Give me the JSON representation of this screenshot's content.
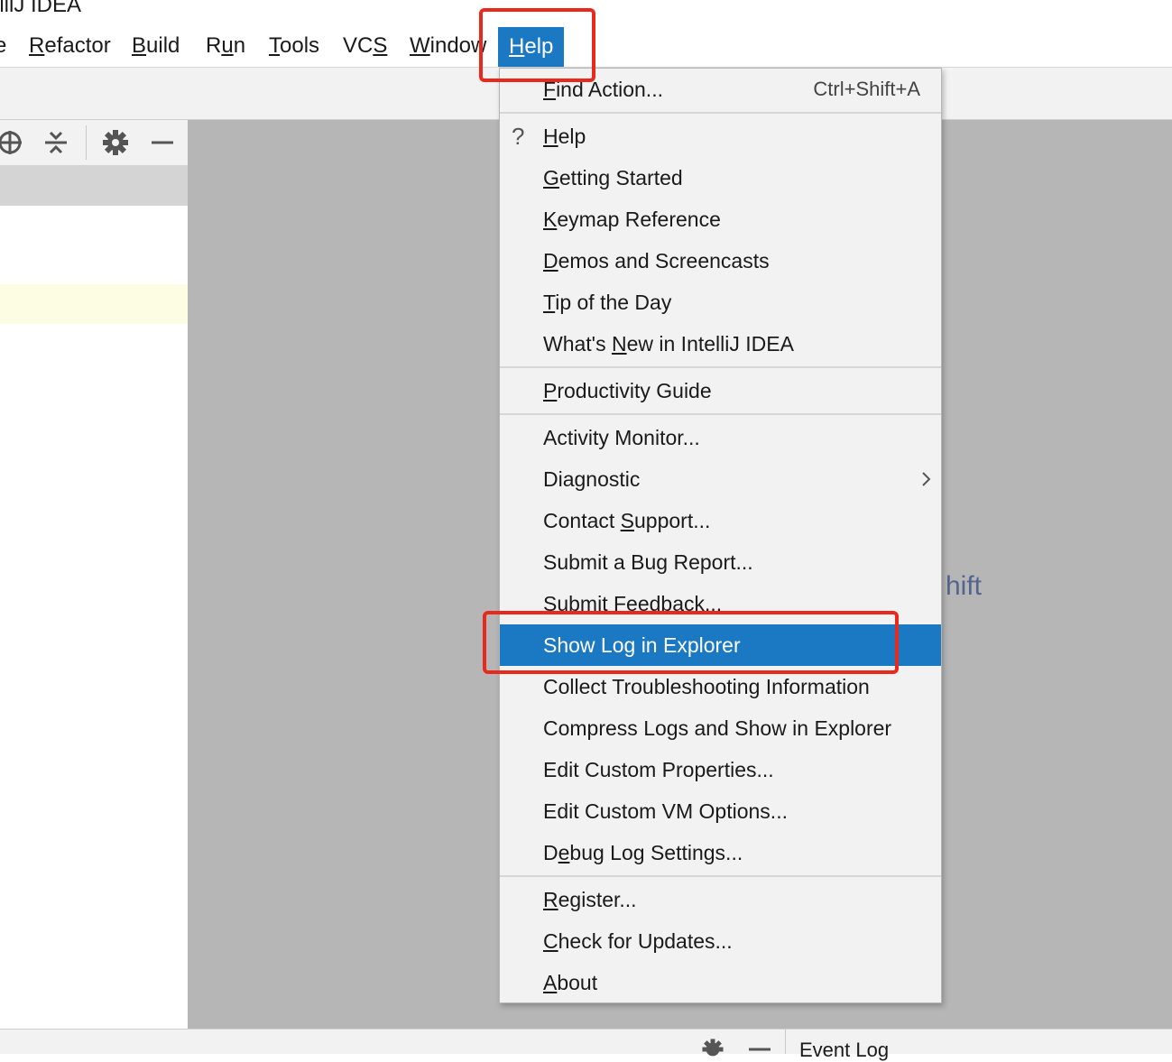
{
  "window": {
    "title": "elliJ IDEA"
  },
  "menubar": {
    "items": [
      {
        "label": "e"
      },
      {
        "label": "Refactor"
      },
      {
        "label": "Build"
      },
      {
        "label": "Run"
      },
      {
        "label": "Tools"
      },
      {
        "label": "VCS"
      },
      {
        "label": "Window"
      },
      {
        "label": "Help",
        "active": true
      }
    ]
  },
  "help_menu": {
    "groups": [
      [
        {
          "label": "Find Action...",
          "shortcut": "Ctrl+Shift+A"
        }
      ],
      [
        {
          "label": "Help",
          "icon": "question-icon"
        },
        {
          "label": "Getting Started"
        },
        {
          "label": "Keymap Reference"
        },
        {
          "label": "Demos and Screencasts"
        },
        {
          "label": "Tip of the Day"
        },
        {
          "label": "What's New in IntelliJ IDEA"
        }
      ],
      [
        {
          "label": "Productivity Guide"
        }
      ],
      [
        {
          "label": "Activity Monitor..."
        },
        {
          "label": "Diagnostic",
          "submenu": true
        },
        {
          "label": "Contact Support..."
        },
        {
          "label": "Submit a Bug Report..."
        },
        {
          "label": "Submit Feedback..."
        },
        {
          "label": "Show Log in Explorer",
          "selected": true
        },
        {
          "label": "Collect Troubleshooting Information"
        },
        {
          "label": "Compress Logs and Show in Explorer"
        },
        {
          "label": "Edit Custom Properties..."
        },
        {
          "label": "Edit Custom VM Options..."
        },
        {
          "label": "Debug Log Settings..."
        }
      ],
      [
        {
          "label": "Register..."
        },
        {
          "label": "Check for Updates..."
        },
        {
          "label": "About"
        }
      ]
    ]
  },
  "editor": {
    "hint_text": "hift"
  },
  "bottombar": {
    "event_log_label": "Event Log"
  },
  "colors": {
    "accent": "#1b78c2",
    "annotation": "#e8291c",
    "editor_bg": "#b6b6b6"
  },
  "icons": {
    "left_toolbar": [
      "locate-icon",
      "collapse-all-icon",
      "gear-icon",
      "minimize-icon"
    ],
    "bottom": [
      "gear-icon",
      "minimize-icon"
    ]
  }
}
